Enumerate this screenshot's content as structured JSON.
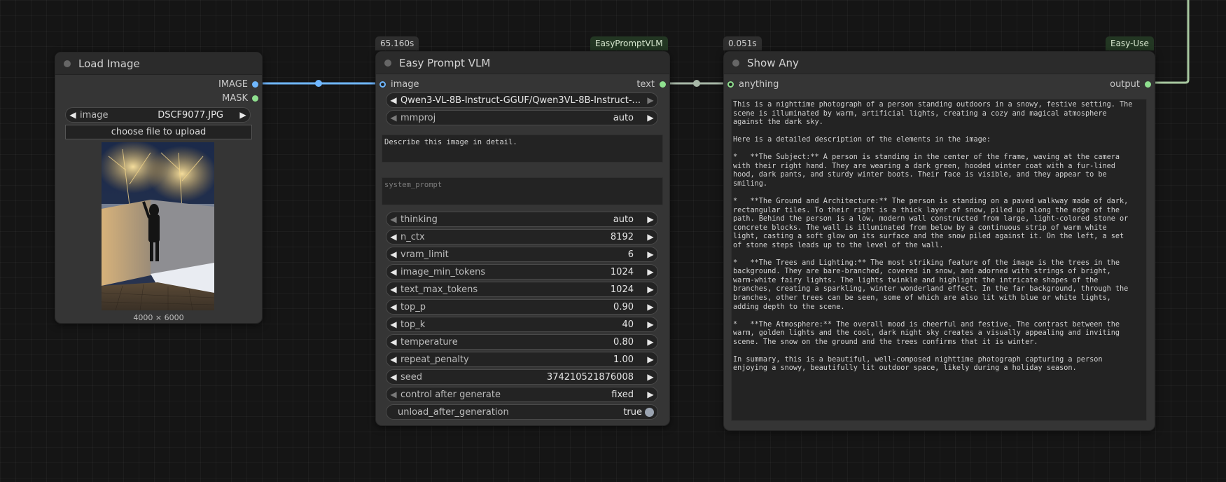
{
  "load_image": {
    "title": "Load Image",
    "outputs": [
      "IMAGE",
      "MASK"
    ],
    "image_widget": {
      "label": "image",
      "value": "DSCF9077.JPG"
    },
    "upload_label": "choose file to upload",
    "dimensions": "4000 × 6000"
  },
  "vlm": {
    "timing": "65.160s",
    "badge": "EasyPromptVLM",
    "title": "Easy Prompt VLM",
    "input": "image",
    "output": "text",
    "model": "Qwen3-VL-8B-Instruct-GGUF/Qwen3VL-8B-Instruct-...",
    "mmproj": {
      "label": "mmproj",
      "value": "auto"
    },
    "prompt": "Describe this image in detail.",
    "system_prompt_placeholder": "system_prompt",
    "widgets": [
      {
        "label": "thinking",
        "value": "auto"
      },
      {
        "label": "n_ctx",
        "value": "8192"
      },
      {
        "label": "vram_limit",
        "value": "6"
      },
      {
        "label": "image_min_tokens",
        "value": "1024"
      },
      {
        "label": "text_max_tokens",
        "value": "1024"
      },
      {
        "label": "top_p",
        "value": "0.90"
      },
      {
        "label": "top_k",
        "value": "40"
      },
      {
        "label": "temperature",
        "value": "0.80"
      },
      {
        "label": "repeat_penalty",
        "value": "1.00"
      },
      {
        "label": "seed",
        "value": "374210521876008"
      },
      {
        "label": "control after generate",
        "value": "fixed"
      }
    ],
    "unload": {
      "label": "unload_after_generation",
      "value": "true"
    }
  },
  "show_any": {
    "timing": "0.051s",
    "badge": "Easy-Use",
    "title": "Show Any",
    "input": "anything",
    "output": "output",
    "text": "This is a nighttime photograph of a person standing outdoors in a snowy, festive setting. The\nscene is illuminated by warm, artificial lights, creating a cozy and magical atmosphere\nagainst the dark sky.\n\nHere is a detailed description of the elements in the image:\n\n*   **The Subject:** A person is standing in the center of the frame, waving at the camera\nwith their right hand. They are wearing a dark green, hooded winter coat with a fur-lined\nhood, dark pants, and sturdy winter boots. Their face is visible, and they appear to be\nsmiling.\n\n*   **The Ground and Architecture:** The person is standing on a paved walkway made of dark,\nrectangular tiles. To their right is a thick layer of snow, piled up along the edge of the\npath. Behind the person is a low, modern wall constructed from large, light-colored stone or\nconcrete blocks. The wall is illuminated from below by a continuous strip of warm white\nlight, casting a soft glow on its surface and the snow piled against it. On the left, a set\nof stone steps leads up to the level of the wall.\n\n*   **The Trees and Lighting:** The most striking feature of the image is the trees in the\nbackground. They are bare-branched, covered in snow, and adorned with strings of bright,\nwarm-white fairy lights. The lights twinkle and highlight the intricate shapes of the\nbranches, creating a sparkling, winter wonderland effect. In the far background, through the\nbranches, other trees can be seen, some of which are also lit with blue or white lights,\nadding depth to the scene.\n\n*   **The Atmosphere:** The overall mood is cheerful and festive. The contrast between the\nwarm, golden lights and the cool, dark night sky creates a visually appealing and inviting\nscene. The snow on the ground and the trees confirms that it is winter.\n\nIn summary, this is a beautiful, well-composed nighttime photograph capturing a person\nenjoying a snowy, beautifully lit outdoor space, likely during a holiday season."
  },
  "colors": {
    "image_link": "#6fb7ff",
    "text_link": "#a8b8a8",
    "output_link": "#a8c8a0"
  }
}
